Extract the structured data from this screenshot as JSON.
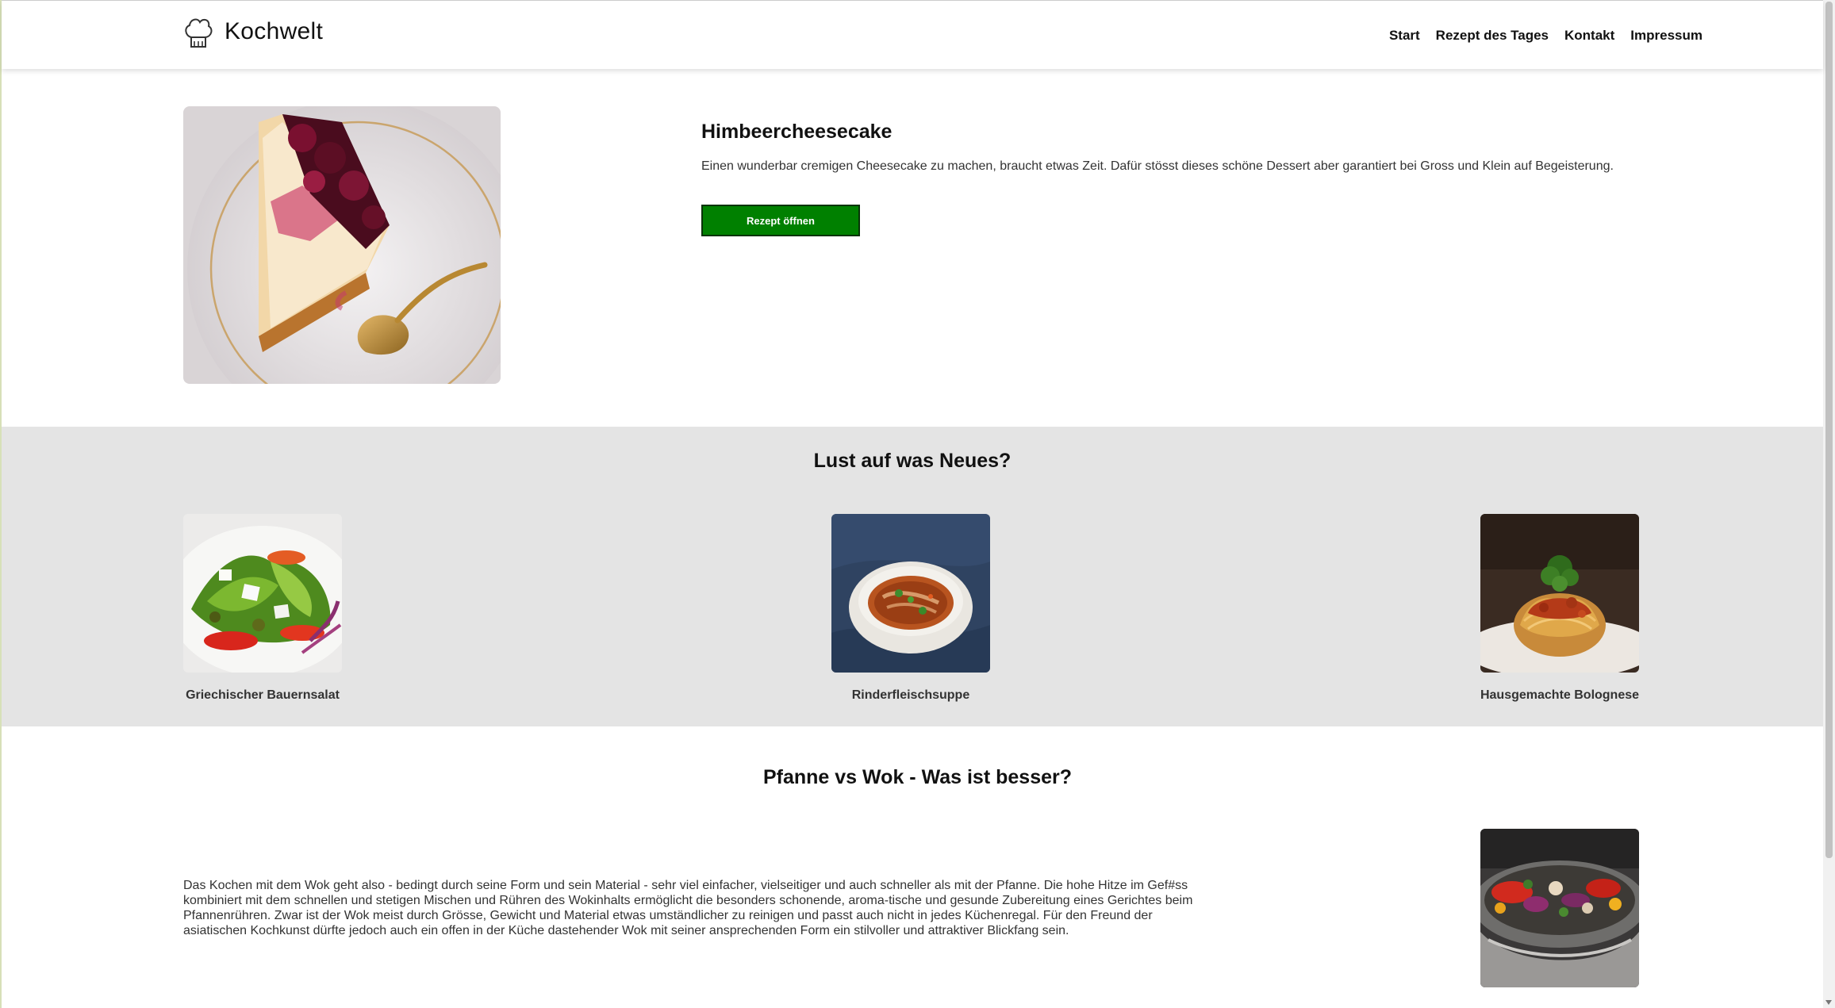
{
  "brand": {
    "name": "Kochwelt",
    "icon": "chef-hat-icon"
  },
  "nav": [
    {
      "label": "Start"
    },
    {
      "label": "Rezept des Tages"
    },
    {
      "label": "Kontakt"
    },
    {
      "label": "Impressum"
    }
  ],
  "hero": {
    "title": "Himbeercheesecake",
    "description": "Einen wunderbar cremigen Cheesecake zu machen, braucht etwas Zeit. Dafür stösst dieses schöne Dessert aber garantiert bei Gross und Klein auf Begeisterung.",
    "button_label": "Rezept öffnen",
    "button_color": "#008000"
  },
  "new_section": {
    "title": "Lust auf was Neues?",
    "background": "#e4e4e4",
    "recipes": [
      {
        "label": "Griechischer Bauernsalat"
      },
      {
        "label": "Rinderfleischsuppe"
      },
      {
        "label": "Hausgemachte Bolognese"
      }
    ]
  },
  "article": {
    "title": "Pfanne vs Wok - Was ist besser?",
    "text": "Das Kochen mit dem Wok geht also - bedingt durch seine Form und sein Material - sehr viel einfacher, vielseitiger und auch schneller als mit der Pfanne. Die hohe Hitze im Gef#ss kombiniert mit dem schnellen und stetigen Mischen und Rühren des Wokinhalts ermöglicht die besonders schonende, aroma-tische und gesunde Zubereitung eines Gerichtes beim Pfannenrühren. Zwar ist der Wok meist durch Grösse, Gewicht und Material etwas umständlicher zu reinigen und passt auch nicht in jedes Küchenregal. Für den Freund der asiatischen Kochkunst dürfte jedoch auch ein offen in der Küche dastehender Wok mit seiner ansprechenden Form ein stilvoller und attraktiver Blickfang sein."
  }
}
